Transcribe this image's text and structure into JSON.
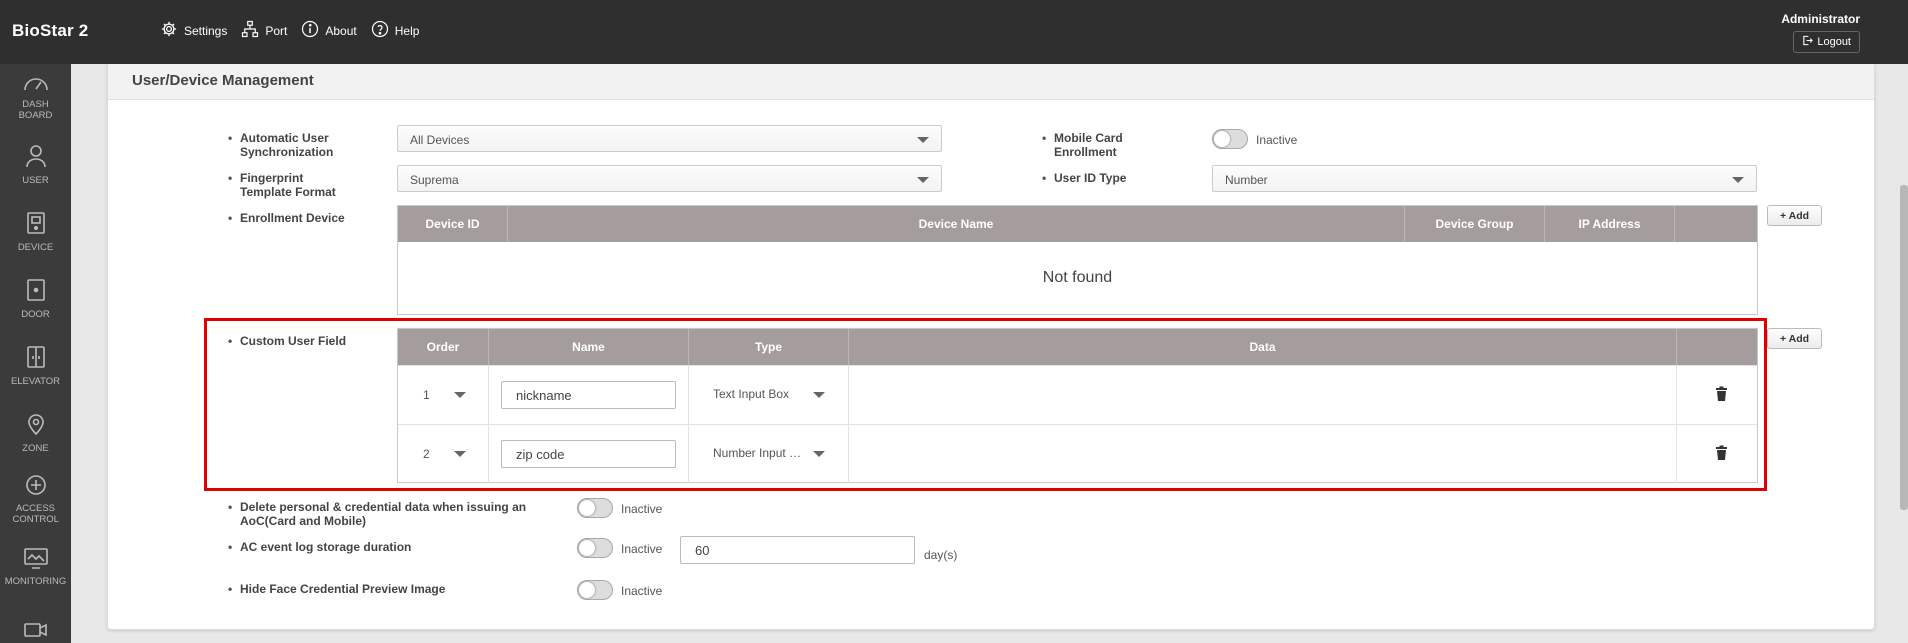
{
  "app": {
    "brand": "BioStar 2",
    "nav": [
      {
        "label": "Settings",
        "icon": "gear-icon"
      },
      {
        "label": "Port",
        "icon": "network-icon"
      },
      {
        "label": "About",
        "icon": "info-icon"
      },
      {
        "label": "Help",
        "icon": "help-icon"
      }
    ],
    "user": "Administrator",
    "logout_label": "Logout"
  },
  "sidebar": {
    "items": [
      {
        "label": "DASH BOARD",
        "icon": "gauge-icon"
      },
      {
        "label": "USER",
        "icon": "user-icon"
      },
      {
        "label": "DEVICE",
        "icon": "device-icon"
      },
      {
        "label": "DOOR",
        "icon": "door-icon"
      },
      {
        "label": "ELEVATOR",
        "icon": "elevator-icon"
      },
      {
        "label": "ZONE",
        "icon": "location-pin-icon"
      },
      {
        "label": "ACCESS CONTROL",
        "icon": "access-control-icon"
      },
      {
        "label": "MONITORING",
        "icon": "monitor-icon"
      },
      {
        "label": "",
        "icon": "video-icon"
      }
    ]
  },
  "panel": {
    "title": "User/Device Management",
    "auto_sync": {
      "label_line1": "Automatic User",
      "label_line2": "Synchronization",
      "value": "All Devices"
    },
    "fingerprint": {
      "label_line1": "Fingerprint",
      "label_line2": "Template Format",
      "value": "Suprema"
    },
    "mobile_card": {
      "label_line1": "Mobile Card",
      "label_line2": "Enrollment",
      "state": "Inactive"
    },
    "user_id_type": {
      "label": "User ID Type",
      "value": "Number"
    },
    "enrollment_device": {
      "label": "Enrollment Device",
      "add_label": "+ Add",
      "columns": [
        "Device ID",
        "Device Name",
        "Device Group",
        "IP Address",
        ""
      ],
      "empty_message": "Not found"
    },
    "custom_user_field": {
      "label": "Custom User Field",
      "add_label": "+ Add",
      "columns": [
        "Order",
        "Name",
        "Type",
        "Data",
        ""
      ],
      "rows": [
        {
          "order": "1",
          "name": "nickname",
          "type": "Text Input Box"
        },
        {
          "order": "2",
          "name": "zip code",
          "type": "Number Input Box"
        }
      ]
    },
    "delete_personal": {
      "label_line1": "Delete personal & credential data when issuing an",
      "label_line2": "AoC(Card and Mobile)",
      "state": "Inactive"
    },
    "ac_event_log": {
      "label": "AC event log storage duration",
      "state": "Inactive",
      "value": "60",
      "unit": "day(s)"
    },
    "hide_face": {
      "label": "Hide Face Credential Preview Image",
      "state": "Inactive"
    }
  },
  "colors": {
    "topbar": "#2f2f2f",
    "sidebar": "#3b3b3b",
    "table_header": "#a59d9d",
    "highlight_border": "#e00000"
  }
}
